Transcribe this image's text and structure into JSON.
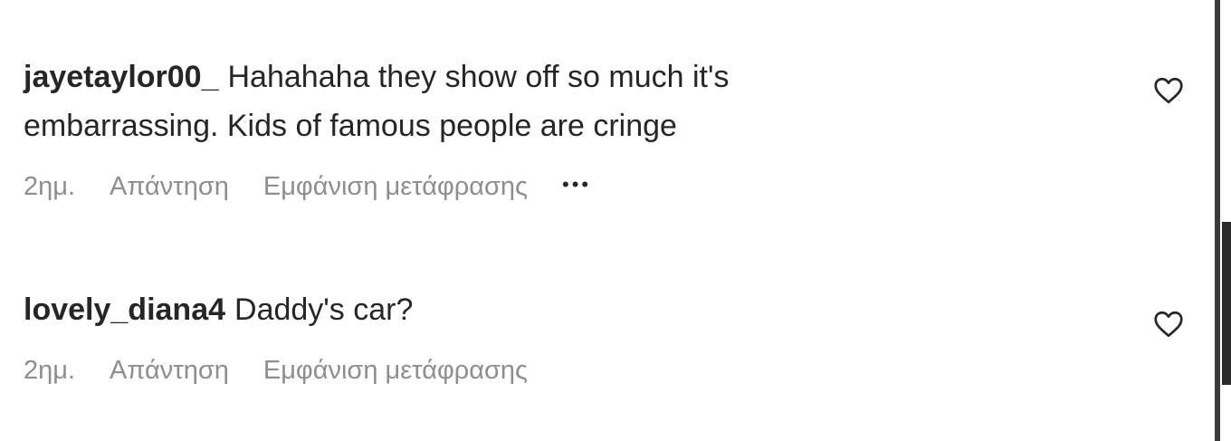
{
  "comments": [
    {
      "username": "jayetaylor00_",
      "text": "Hahahaha they show off so much it's embarrassing. Kids of famous people are cringe",
      "time": "2ημ.",
      "reply_label": "Απάντηση",
      "translate_label": "Εμφάνιση μετάφρασης",
      "more_label": "•••",
      "like_icon": "heart-outline-icon"
    },
    {
      "username": "lovely_diana4",
      "text": "Daddy's car?",
      "time": "2ημ.",
      "reply_label": "Απάντηση",
      "translate_label": "Εμφάνιση μετάφρασης",
      "like_icon": "heart-outline-icon"
    }
  ],
  "colors": {
    "text_primary": "#262626",
    "text_secondary": "#8e8e8e",
    "background": "#ffffff"
  }
}
